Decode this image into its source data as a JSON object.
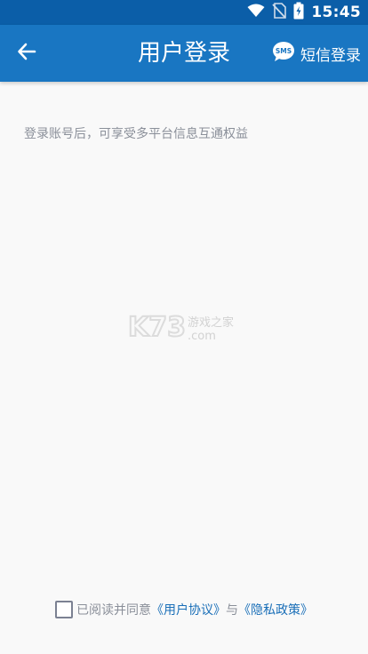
{
  "status_bar": {
    "time": "15:45",
    "icons": [
      "wifi-icon",
      "no-sim-icon",
      "battery-charging-icon"
    ],
    "bg_color": "#0b5ea8"
  },
  "app_bar": {
    "title": "用户登录",
    "back_icon": "arrow-left-icon",
    "sms_icon": "sms-bubble-icon",
    "sms_icon_text": "SMS",
    "sms_login_label": "短信登录",
    "bg_color": "#1976c2"
  },
  "main": {
    "hint": "登录账号后，可享受多平台信息互通权益"
  },
  "watermark": {
    "logo_text": "K73",
    "tagline": "游戏之家",
    "domain": ".com"
  },
  "agreement": {
    "checked": false,
    "prefix": "已阅读并同意",
    "user_agreement_link": "《用户协议》",
    "conjunction": "与",
    "privacy_policy_link": "《隐私政策》",
    "link_color": "#1a6fb8"
  }
}
